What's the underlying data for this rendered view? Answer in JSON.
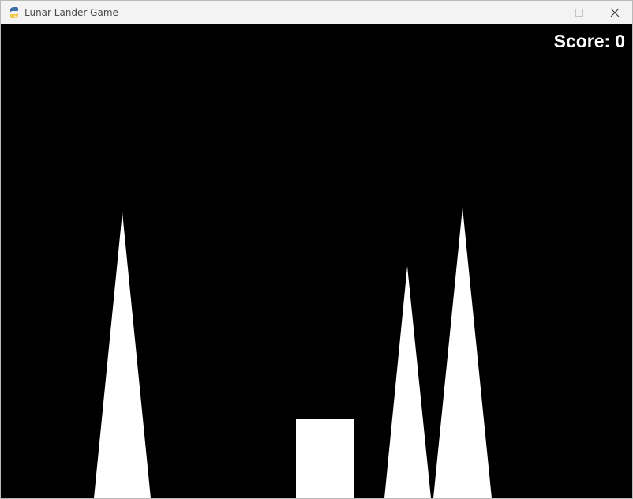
{
  "window": {
    "title": "Lunar Lander Game",
    "app_icon": "python-icon",
    "controls": [
      "minimize-icon",
      "maximize-icon",
      "close-icon"
    ]
  },
  "game": {
    "background_color": "#000000",
    "terrain_color": "#ffffff",
    "score_label": "Score:",
    "score_value": "0",
    "objects": [
      "mountain-spike",
      "landing-pad",
      "mountain-spike",
      "mountain-spike"
    ]
  }
}
